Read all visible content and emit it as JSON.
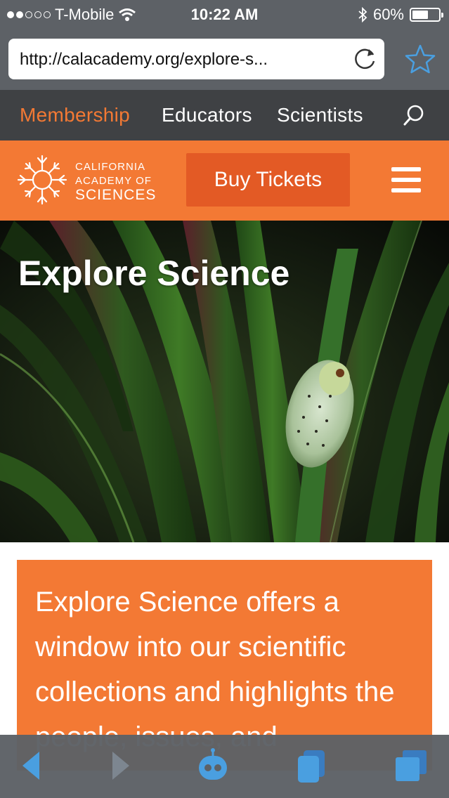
{
  "status_bar": {
    "carrier": "T-Mobile",
    "time": "10:22 AM",
    "battery": "60%",
    "battery_level": 0.6,
    "signal_bars_filled": 2,
    "signal_bars_total": 5
  },
  "browser": {
    "url": "http://calacademy.org/explore-s..."
  },
  "top_nav": {
    "items": [
      {
        "label": "Membership",
        "active": true
      },
      {
        "label": "Educators",
        "active": false
      },
      {
        "label": "Scientists",
        "active": false
      }
    ]
  },
  "header": {
    "logo_line1": "CALIFORNIA",
    "logo_line2": "ACADEMY OF",
    "logo_line3": "SCIENCES",
    "buy_button": "Buy Tickets"
  },
  "hero": {
    "title": "Explore Science"
  },
  "intro": {
    "text": "Explore Science offers a window into our scientific collections and highlights the people, issues, and"
  },
  "colors": {
    "accent": "#f37934",
    "button": "#e35a25",
    "nav_bg": "#3f4144",
    "chrome_bg": "#5d6166",
    "ios_blue": "#4a9fe0"
  },
  "icons": {
    "wifi": "wifi-icon",
    "bluetooth": "bluetooth-icon",
    "reload": "reload-icon",
    "bookmark": "star-icon",
    "search": "search-icon",
    "menu": "hamburger-icon",
    "back": "back-arrow-icon",
    "forward": "forward-arrow-icon",
    "assistant": "robot-icon",
    "bookmarks": "bookmarks-icon",
    "tabs": "tabs-icon"
  }
}
